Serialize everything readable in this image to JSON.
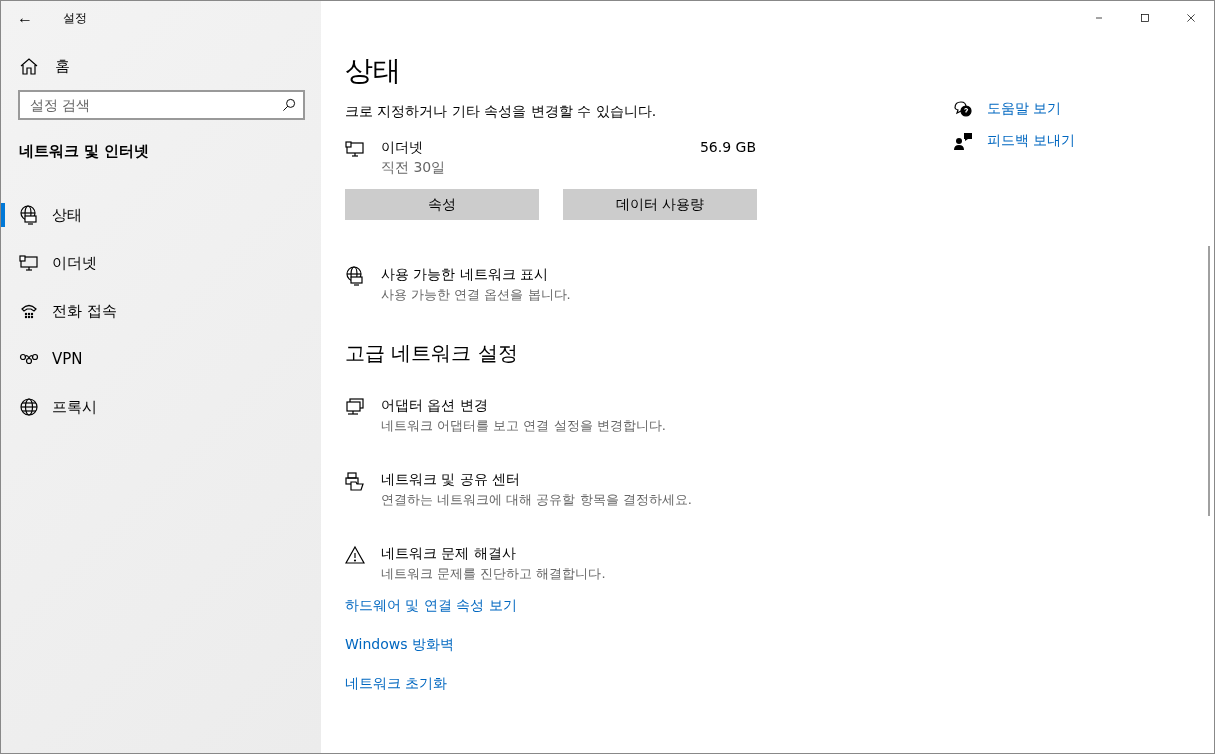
{
  "window": {
    "title": "설정",
    "back": "←"
  },
  "sidebar": {
    "home": "홈",
    "search": {
      "placeholder": "설정 검색"
    },
    "section": "네트워크 및 인터넷",
    "items": [
      {
        "label": "상태",
        "kind": "status",
        "selected": true
      },
      {
        "label": "이더넷",
        "kind": "ethernet",
        "selected": false
      },
      {
        "label": "전화 접속",
        "kind": "dialup",
        "selected": false
      },
      {
        "label": "VPN",
        "kind": "vpn",
        "selected": false
      },
      {
        "label": "프록시",
        "kind": "globe",
        "selected": false
      }
    ]
  },
  "page": {
    "title": "상태",
    "intro": "크로 지정하거나 기타 속성을 변경할 수 있습니다.",
    "connection": {
      "name": "이더넷",
      "detail": "직전 30일",
      "usage": "56.9 GB"
    },
    "buttons": [
      "속성",
      "데이터 사용량"
    ],
    "show_networks": {
      "title": "사용 가능한 네트워크 표시",
      "subtitle": "사용 가능한 연결 옵션을 봅니다.",
      "kind": "status"
    },
    "advanced_heading": "고급 네트워크 설정",
    "advanced": [
      {
        "title": "어댑터 옵션 변경",
        "subtitle": "네트워크 어댑터를 보고 연결 설정을 변경합니다.",
        "kind": "adapter"
      },
      {
        "title": "네트워크 및 공유 센터",
        "subtitle": "연결하는 네트워크에 대해 공유할 항목을 결정하세요.",
        "kind": "sharing"
      },
      {
        "title": "네트워크 문제 해결사",
        "subtitle": "네트워크 문제를 진단하고 해결합니다.",
        "kind": "warning"
      }
    ],
    "links": [
      "하드웨어 및 연결 속성 보기",
      "Windows 방화벽",
      "네트워크 초기화"
    ]
  },
  "help": [
    {
      "label": "도움말 보기",
      "kind": "help"
    },
    {
      "label": "피드백 보내기",
      "kind": "feedback"
    }
  ]
}
